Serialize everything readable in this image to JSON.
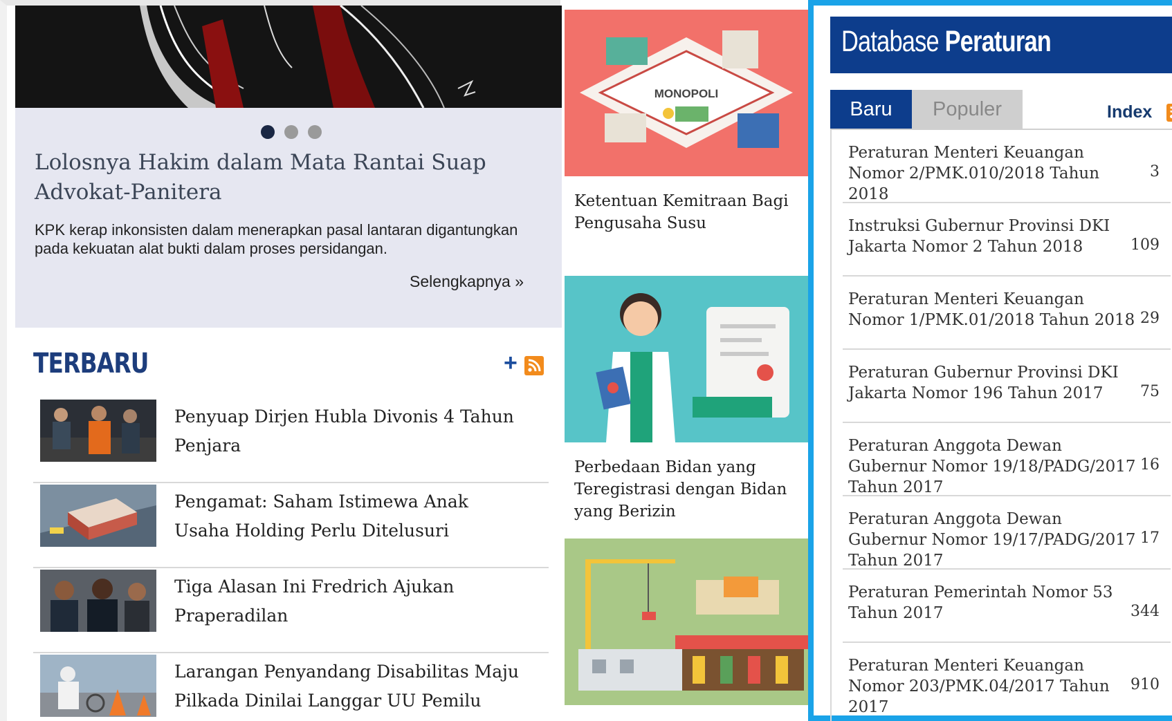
{
  "hero": {
    "title": "Lolosnya Hakim dalam Mata Rantai Suap Advokat-Panitera",
    "summary": "KPK kerap inkonsisten dalam menerapkan pasal lantaran digantungkan pada kekuatan alat bukti dalam proses persidangan.",
    "more_label": "Selengkapnya  »",
    "slide_count": 3,
    "active_slide": 1
  },
  "terbaru": {
    "heading": "TERBARU",
    "plus": "+",
    "items": [
      {
        "title": "Penyuap Dirjen Hubla Divonis 4 Tahun Penjara"
      },
      {
        "title": "Pengamat: Saham Istimewa Anak Usaha Holding Perlu Ditelusuri"
      },
      {
        "title": "Tiga Alasan Ini Fredrich Ajukan Praperadilan"
      },
      {
        "title": "Larangan Penyandang Disabilitas Maju Pilkada Dinilai Langgar UU Pemilu"
      }
    ]
  },
  "middle": {
    "cards": [
      {
        "title": "Ketentuan Kemitraan Bagi Pengusaha Susu",
        "image_label": "MONOPOLI"
      },
      {
        "title": "Perbedaan Bidan yang Teregistrasi dengan Bidan yang Berizin"
      },
      {
        "title": ""
      }
    ]
  },
  "database": {
    "title_light": "Database ",
    "title_bold": "Peraturan",
    "tabs": {
      "baru": "Baru",
      "populer": "Populer"
    },
    "index_label": "Index",
    "items": [
      {
        "title": "Peraturan Menteri Keuangan Nomor 2/PMK.010/2018 Tahun 2018",
        "count": "3"
      },
      {
        "title": "Instruksi Gubernur Provinsi DKI Jakarta Nomor 2 Tahun 2018",
        "count": "109"
      },
      {
        "title": "Peraturan Menteri Keuangan Nomor 1/PMK.01/2018 Tahun 2018",
        "count": "29"
      },
      {
        "title": "Peraturan Gubernur Provinsi DKI Jakarta Nomor 196 Tahun 2017",
        "count": "75"
      },
      {
        "title": "Peraturan Anggota Dewan Gubernur Nomor 19/18/PADG/2017 Tahun 2017",
        "count": "16"
      },
      {
        "title": "Peraturan Anggota Dewan Gubernur Nomor 19/17/PADG/2017 Tahun 2017",
        "count": "17"
      },
      {
        "title": "Peraturan Pemerintah Nomor 53 Tahun 2017",
        "count": "344"
      },
      {
        "title": "Peraturan Menteri Keuangan Nomor 203/PMK.04/2017 Tahun 2017",
        "count": "910"
      }
    ]
  },
  "colors": {
    "accent_blue": "#0d3d8c",
    "frame_blue": "#1aa3e8",
    "rss_orange": "#f28b1c",
    "hero_bg": "#e6e7f1"
  }
}
